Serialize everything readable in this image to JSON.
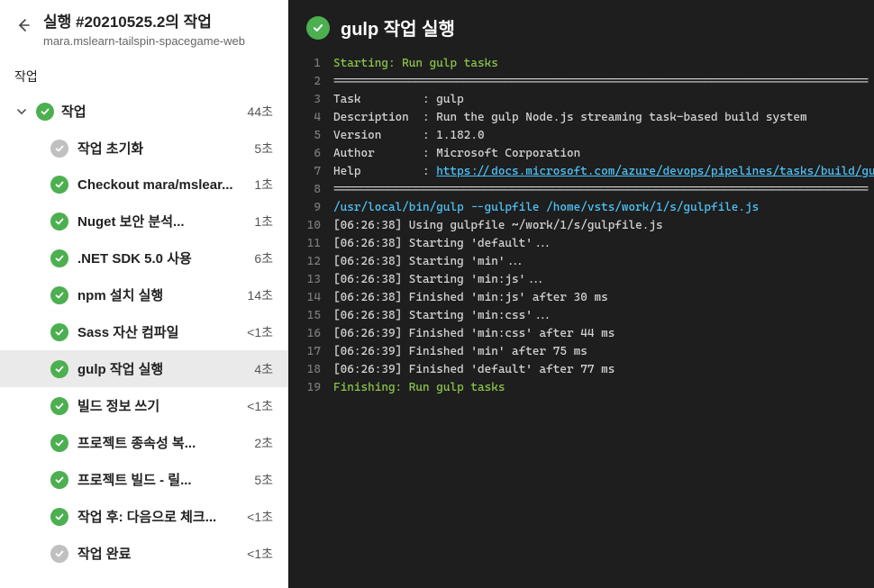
{
  "header": {
    "title": "실행 #20210525.2의 작업",
    "subtitle": "mara.mslearn-tailspin-spacegame-web"
  },
  "sectionLabel": "작업",
  "jobGroup": {
    "label": "작업",
    "duration": "44초"
  },
  "tasks": [
    {
      "label": "작업 초기화",
      "duration": "5초",
      "status": "neutral",
      "selected": false
    },
    {
      "label": "Checkout mara/mslear...",
      "duration": "1초",
      "status": "success",
      "selected": false
    },
    {
      "label": "Nuget 보안 분석...",
      "duration": "1초",
      "status": "success",
      "selected": false
    },
    {
      "label": ".NET SDK 5.0 사용",
      "duration": "6초",
      "status": "success",
      "selected": false
    },
    {
      "label": "npm 설치 실행",
      "duration": "14초",
      "status": "success",
      "selected": false
    },
    {
      "label": "Sass 자산 컴파일",
      "duration": "<1초",
      "status": "success",
      "selected": false
    },
    {
      "label": "gulp 작업 실행",
      "duration": "4초",
      "status": "success",
      "selected": true
    },
    {
      "label": "빌드 정보 쓰기",
      "duration": "<1초",
      "status": "success",
      "selected": false
    },
    {
      "label": "프로젝트 종속성 복...",
      "duration": "2초",
      "status": "success",
      "selected": false
    },
    {
      "label": "프로젝트 빌드 - 릴...",
      "duration": "5초",
      "status": "success",
      "selected": false
    },
    {
      "label": "작업 후: 다음으로 체크...",
      "duration": "<1초",
      "status": "success",
      "selected": false
    },
    {
      "label": "작업 완료",
      "duration": "<1초",
      "status": "neutral",
      "selected": false
    }
  ],
  "main": {
    "title": "gulp 작업 실행",
    "helpUrl": "https://docs.microsoft.com/azure/devops/pipelines/tasks/build/gulp",
    "log": [
      {
        "n": 1,
        "segs": [
          {
            "t": "Starting: Run gulp tasks",
            "c": "green"
          }
        ]
      },
      {
        "n": 2,
        "segs": [
          {
            "t": "=============================================================================="
          }
        ]
      },
      {
        "n": 3,
        "segs": [
          {
            "t": "Task         : gulp"
          }
        ]
      },
      {
        "n": 4,
        "segs": [
          {
            "t": "Description  : Run the gulp Node.js streaming task-based build system"
          }
        ]
      },
      {
        "n": 5,
        "segs": [
          {
            "t": "Version      : 1.182.0"
          }
        ]
      },
      {
        "n": 6,
        "segs": [
          {
            "t": "Author       : Microsoft Corporation"
          }
        ]
      },
      {
        "n": 7,
        "segs": [
          {
            "t": "Help         : "
          },
          {
            "t": "https://docs.microsoft.com/azure/devops/pipelines/tasks/build/gulp",
            "c": "link"
          }
        ]
      },
      {
        "n": 8,
        "segs": [
          {
            "t": "=============================================================================="
          }
        ]
      },
      {
        "n": 9,
        "segs": [
          {
            "t": "/usr/local/bin/gulp --gulpfile /home/vsts/work/1/s/gulpfile.js",
            "c": "blue"
          }
        ]
      },
      {
        "n": 10,
        "segs": [
          {
            "t": "[06:26:38] Using gulpfile ~/work/1/s/gulpfile.js"
          }
        ]
      },
      {
        "n": 11,
        "segs": [
          {
            "t": "[06:26:38] Starting 'default'..."
          }
        ]
      },
      {
        "n": 12,
        "segs": [
          {
            "t": "[06:26:38] Starting 'min'..."
          }
        ]
      },
      {
        "n": 13,
        "segs": [
          {
            "t": "[06:26:38] Starting 'min:js'..."
          }
        ]
      },
      {
        "n": 14,
        "segs": [
          {
            "t": "[06:26:38] Finished 'min:js' after 30 ms"
          }
        ]
      },
      {
        "n": 15,
        "segs": [
          {
            "t": "[06:26:38] Starting 'min:css'..."
          }
        ]
      },
      {
        "n": 16,
        "segs": [
          {
            "t": "[06:26:39] Finished 'min:css' after 44 ms"
          }
        ]
      },
      {
        "n": 17,
        "segs": [
          {
            "t": "[06:26:39] Finished 'min' after 75 ms"
          }
        ]
      },
      {
        "n": 18,
        "segs": [
          {
            "t": "[06:26:39] Finished 'default' after 77 ms"
          }
        ]
      },
      {
        "n": 19,
        "segs": [
          {
            "t": "Finishing: Run gulp tasks",
            "c": "green"
          }
        ]
      }
    ]
  }
}
